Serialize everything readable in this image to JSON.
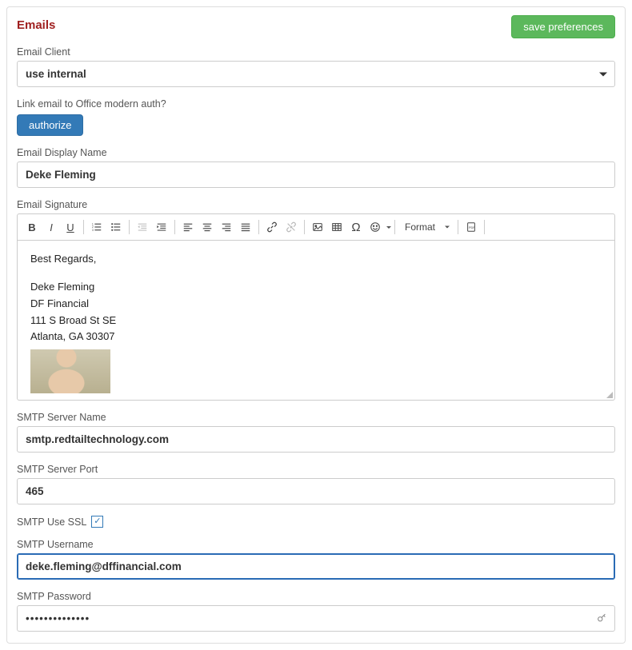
{
  "header": {
    "title": "Emails",
    "save_label": "save preferences"
  },
  "email_client": {
    "label": "Email Client",
    "value": "use internal"
  },
  "office_auth": {
    "label": "Link email to Office modern auth?",
    "button": "authorize"
  },
  "display_name": {
    "label": "Email Display Name",
    "value": "Deke Fleming"
  },
  "signature": {
    "label": "Email Signature",
    "toolbar": {
      "format_label": "Format"
    },
    "body": {
      "line1": "Best Regards,",
      "line2": "Deke Fleming",
      "line3": "DF Financial",
      "line4": "111 S Broad St SE",
      "line5": "Atlanta, GA 30307"
    }
  },
  "smtp": {
    "server_label": "SMTP Server Name",
    "server_value": "smtp.redtailtechnology.com",
    "port_label": "SMTP Server Port",
    "port_value": "465",
    "ssl_label": "SMTP Use SSL",
    "ssl_checked": true,
    "user_label": "SMTP Username",
    "user_value": "deke.fleming@dffinancial.com",
    "pass_label": "SMTP Password",
    "pass_value": "••••••••••••••"
  }
}
